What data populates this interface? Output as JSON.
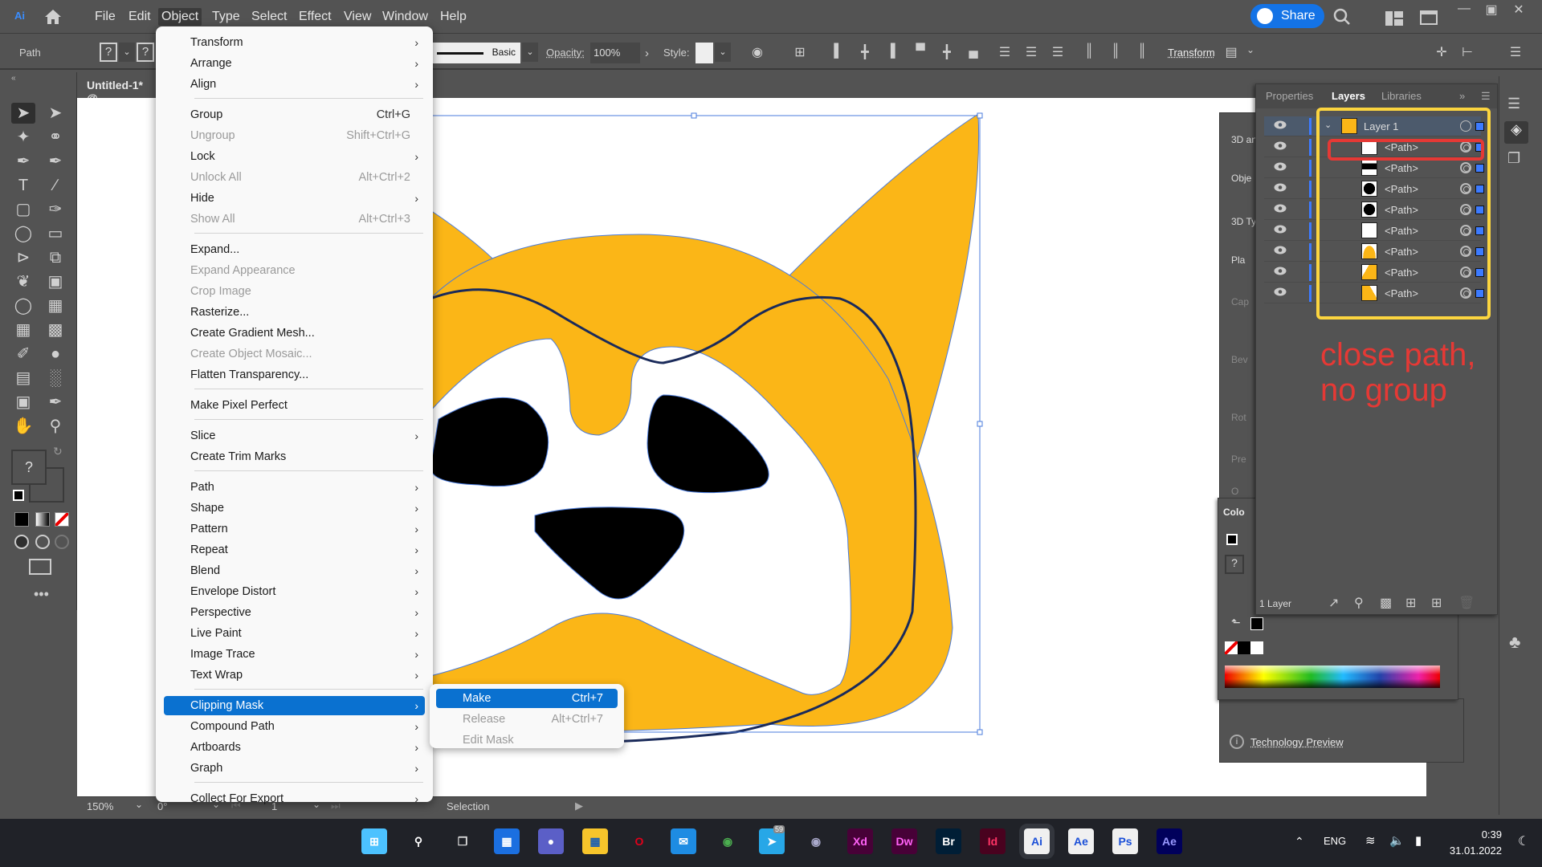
{
  "app": {
    "logo": "Ai",
    "doc_tab": "Untitled-1* @"
  },
  "menubar": {
    "items": [
      "File",
      "Edit",
      "Object",
      "Type",
      "Select",
      "Effect",
      "View",
      "Window",
      "Help"
    ],
    "active": "Object",
    "share_label": "Share"
  },
  "controlbar": {
    "selection_type": "Path",
    "stroke_style": "Basic",
    "opacity_label": "Opacity:",
    "opacity_value": "100%",
    "style_label": "Style:",
    "transform_label": "Transform",
    "fill_placeholder": "?"
  },
  "object_menu": {
    "items": [
      {
        "label": "Transform",
        "submenu": true
      },
      {
        "label": "Arrange",
        "submenu": true
      },
      {
        "label": "Align",
        "submenu": true
      },
      {
        "sep": true
      },
      {
        "label": "Group",
        "shortcut": "Ctrl+G"
      },
      {
        "label": "Ungroup",
        "shortcut": "Shift+Ctrl+G",
        "disabled": true
      },
      {
        "label": "Lock",
        "submenu": true
      },
      {
        "label": "Unlock All",
        "shortcut": "Alt+Ctrl+2",
        "disabled": true
      },
      {
        "label": "Hide",
        "submenu": true
      },
      {
        "label": "Show All",
        "shortcut": "Alt+Ctrl+3",
        "disabled": true
      },
      {
        "sep": true
      },
      {
        "label": "Expand..."
      },
      {
        "label": "Expand Appearance",
        "disabled": true
      },
      {
        "label": "Crop Image",
        "disabled": true
      },
      {
        "label": "Rasterize..."
      },
      {
        "label": "Create Gradient Mesh..."
      },
      {
        "label": "Create Object Mosaic...",
        "disabled": true
      },
      {
        "label": "Flatten Transparency..."
      },
      {
        "sep": true
      },
      {
        "label": "Make Pixel Perfect"
      },
      {
        "sep": true
      },
      {
        "label": "Slice",
        "submenu": true
      },
      {
        "label": "Create Trim Marks"
      },
      {
        "sep": true
      },
      {
        "label": "Path",
        "submenu": true
      },
      {
        "label": "Shape",
        "submenu": true
      },
      {
        "label": "Pattern",
        "submenu": true
      },
      {
        "label": "Repeat",
        "submenu": true
      },
      {
        "label": "Blend",
        "submenu": true
      },
      {
        "label": "Envelope Distort",
        "submenu": true
      },
      {
        "label": "Perspective",
        "submenu": true
      },
      {
        "label": "Live Paint",
        "submenu": true
      },
      {
        "label": "Image Trace",
        "submenu": true
      },
      {
        "label": "Text Wrap",
        "submenu": true
      },
      {
        "sep": true
      },
      {
        "label": "Clipping Mask",
        "submenu": true,
        "highlighted": true
      },
      {
        "label": "Compound Path",
        "submenu": true
      },
      {
        "label": "Artboards",
        "submenu": true
      },
      {
        "label": "Graph",
        "submenu": true
      },
      {
        "sep": true
      },
      {
        "label": "Collect For Export",
        "submenu": true
      }
    ]
  },
  "clipping_submenu": {
    "items": [
      {
        "label": "Make",
        "shortcut": "Ctrl+7",
        "highlighted": true
      },
      {
        "label": "Release",
        "shortcut": "Alt+Ctrl+7",
        "disabled": true
      },
      {
        "label": "Edit Mask",
        "disabled": true
      }
    ]
  },
  "layers_panel": {
    "tabs": [
      "Properties",
      "Layers",
      "Libraries"
    ],
    "active_tab": "Layers",
    "layer_name": "Layer 1",
    "rows": [
      {
        "name": "<Path>",
        "thumb": "white-outline"
      },
      {
        "name": "<Path>",
        "thumb": "black-nose"
      },
      {
        "name": "<Path>",
        "thumb": "black-eye"
      },
      {
        "name": "<Path>",
        "thumb": "black-eye"
      },
      {
        "name": "<Path>",
        "thumb": "white"
      },
      {
        "name": "<Path>",
        "thumb": "yellow-head"
      },
      {
        "name": "<Path>",
        "thumb": "yellow-ear-left"
      },
      {
        "name": "<Path>",
        "thumb": "yellow-ear-right"
      }
    ],
    "footer_count": "1 Layer"
  },
  "annotation": {
    "line1": "close path,",
    "line2": "no group",
    "color": "#e53935",
    "box_color": "#fcd53f"
  },
  "behind_panel": {
    "lines": [
      "3D an",
      "Obje",
      "3D Ty",
      "Pla",
      "Cap",
      "Bev",
      "Rot",
      "Pre",
      "O"
    ]
  },
  "color_panel": {
    "title": "Colo",
    "tech_preview": "Technology Preview"
  },
  "statusbar": {
    "zoom": "150%",
    "rotation": "0°",
    "artboard": "1",
    "tool": "Selection"
  },
  "artwork": {
    "yellow": "#fbb617",
    "black": "#000000",
    "selection_color": "#4a7bdc"
  },
  "taskbar": {
    "apps": [
      "Start",
      "Search",
      "Task View",
      "Widgets",
      "Teams",
      "File Explorer",
      "Opera",
      "Mail",
      "Chrome",
      "Telegram",
      "Cinema 4D",
      "Xd",
      "Dw",
      "Br",
      "Id",
      "Ai",
      "Ae",
      "Ps",
      "Ae"
    ],
    "telegram_badge": "59",
    "lang": "ENG",
    "time": "0:39",
    "date": "31.01.2022"
  }
}
